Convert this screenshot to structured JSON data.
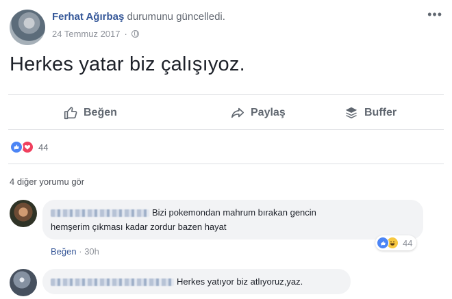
{
  "post": {
    "author": "Ferhat Ağırbaş",
    "action": "durumunu güncelledi.",
    "date": "24 Temmuz 2017",
    "date_separator": "·",
    "more_icon": "more-horizontal-icon",
    "text": "Herkes yatar biz çalışıyoz."
  },
  "actions": {
    "like_label": "Beğen",
    "share_label": "Paylaş",
    "buffer_label": "Buffer"
  },
  "reactions": {
    "count": "44",
    "types": [
      "like",
      "love"
    ]
  },
  "comments_link": "4 diğer yorumu gör",
  "comments": [
    {
      "text": "Bizi pokemondan mahrum bırakan gencin hemşerim çıkması kadar zordur bazen hayat",
      "line1": "Bizi pokemondan mahrum bırakan gencin",
      "line2": "hemşerim çıkması kadar zordur bazen hayat",
      "like_label": "Beğen",
      "separator": "·",
      "time": "30h",
      "reaction_count": "44",
      "reaction_types": [
        "like",
        "haha"
      ]
    },
    {
      "text": "Herkes yatıyor biz atlıyoruz,yaz."
    }
  ],
  "colors": {
    "link": "#365899",
    "like_blue": "#4c85f5",
    "love_red": "#f0405e",
    "haha_yellow": "#f7c840",
    "bubble_bg": "#f2f3f5"
  }
}
